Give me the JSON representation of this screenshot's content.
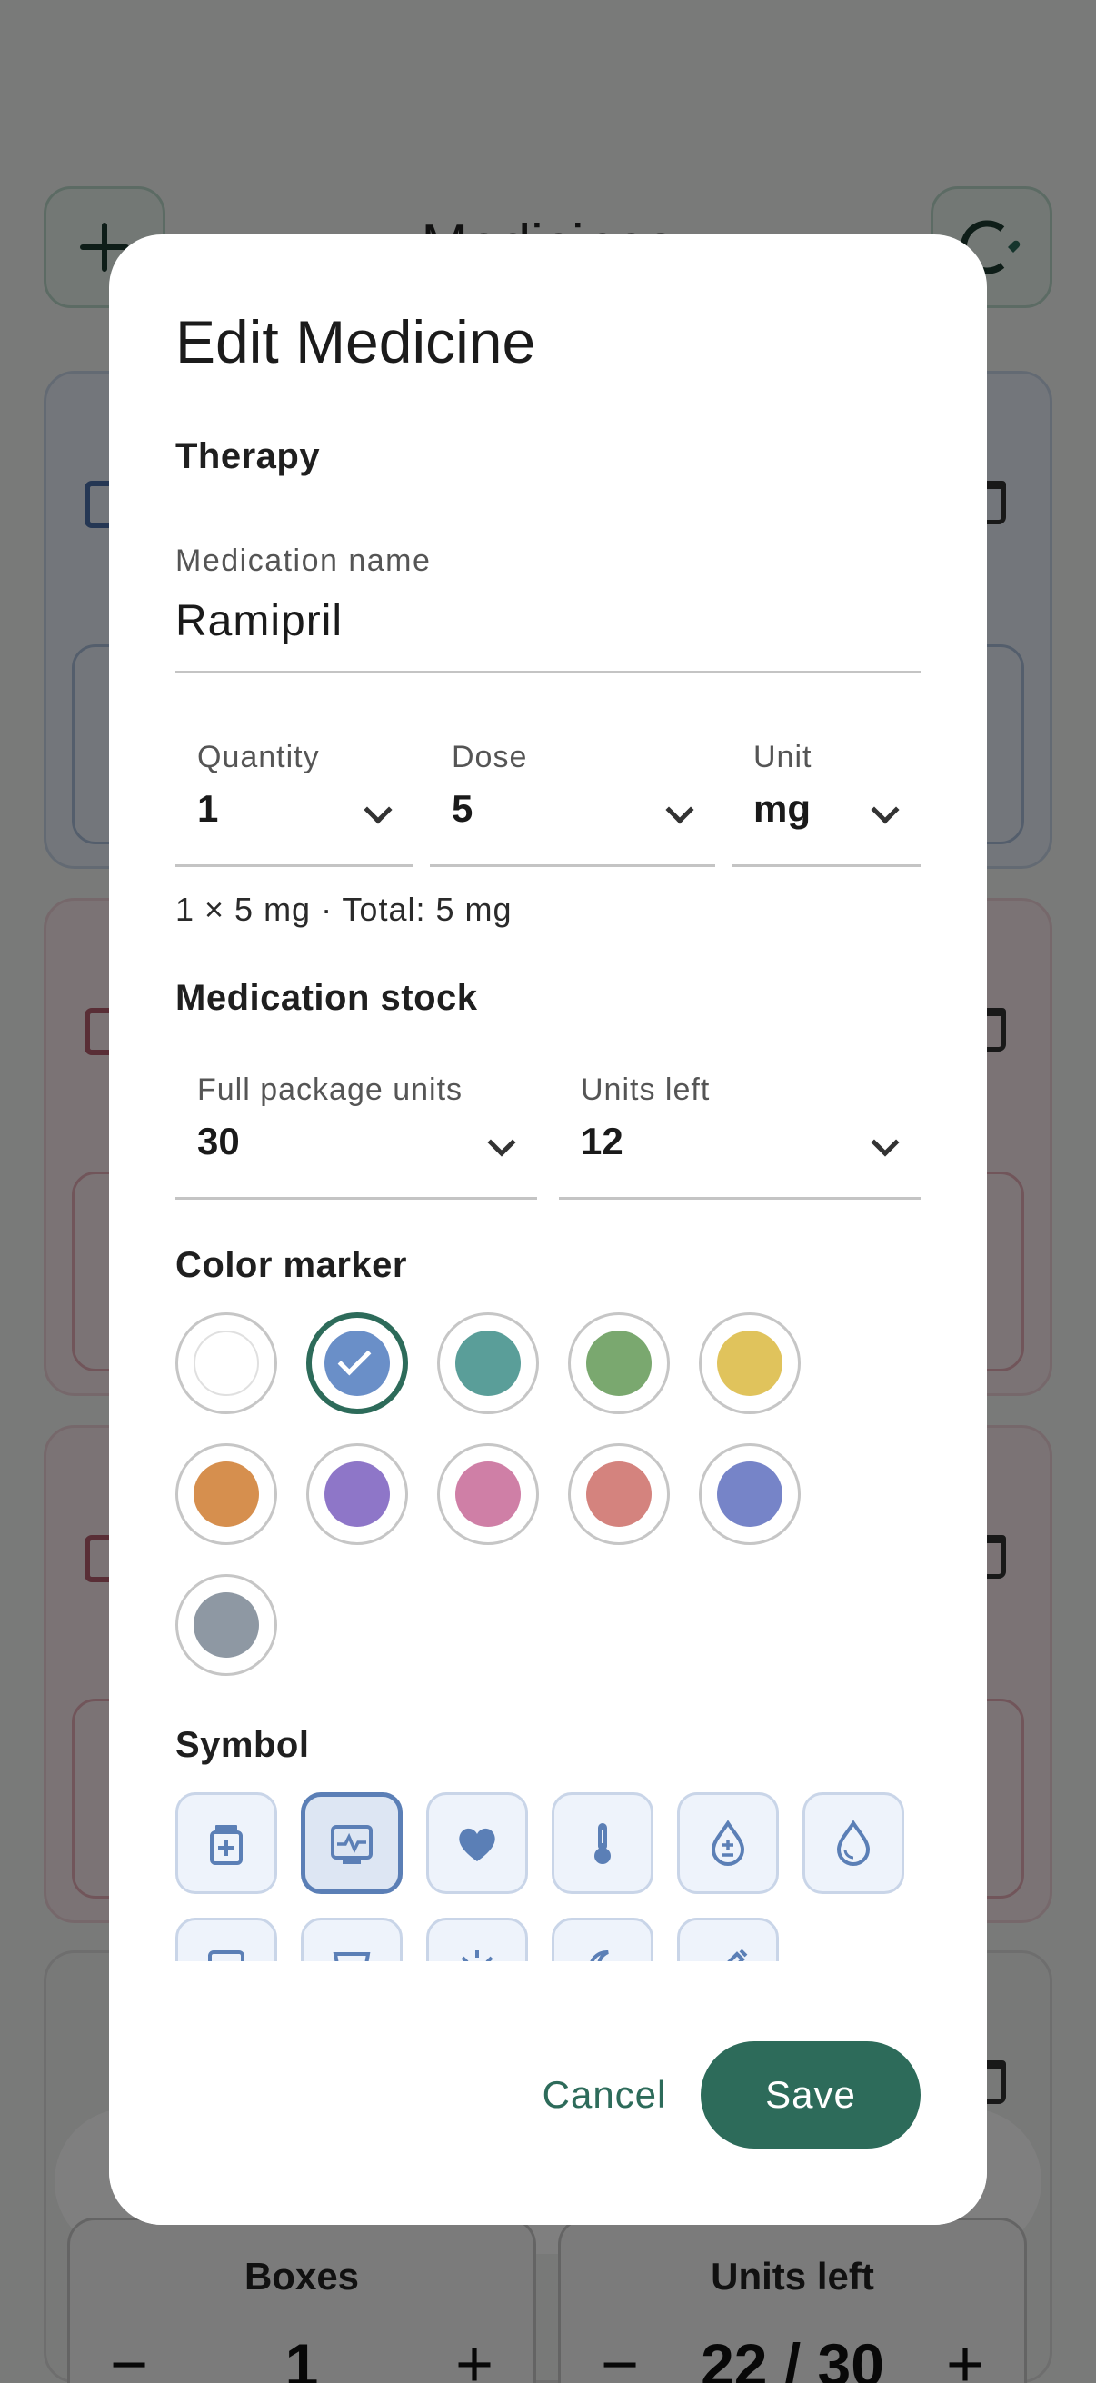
{
  "background": {
    "title": "Medicines",
    "add_icon": "plus-icon",
    "profile_icon": "profile-heart-icon",
    "counters": [
      {
        "label": "Boxes",
        "minus": "−",
        "value": "1",
        "plus": "+"
      },
      {
        "label": "Units left",
        "minus": "−",
        "value": "22 / 30",
        "plus": "+"
      }
    ]
  },
  "dialog": {
    "title": "Edit Medicine",
    "therapy": {
      "section_label": "Therapy",
      "name_label": "Medication name",
      "name_value": "Ramipril",
      "quantity_label": "Quantity",
      "quantity_value": "1",
      "dose_label": "Dose",
      "dose_value": "5",
      "unit_label": "Unit",
      "unit_value": "mg",
      "summary": "1 × 5 mg · Total: 5 mg"
    },
    "stock": {
      "section_label": "Medication stock",
      "full_package_label": "Full package units",
      "full_package_value": "30",
      "units_left_label": "Units left",
      "units_left_value": "12"
    },
    "color_marker": {
      "section_label": "Color marker",
      "selected": "blue",
      "colors": [
        {
          "name": "white",
          "hex": "#ffffff"
        },
        {
          "name": "blue",
          "hex": "#6a8fc8"
        },
        {
          "name": "teal",
          "hex": "#5a9e99"
        },
        {
          "name": "green",
          "hex": "#7aa86f"
        },
        {
          "name": "yellow",
          "hex": "#e0c35c"
        },
        {
          "name": "orange",
          "hex": "#d68f4e"
        },
        {
          "name": "purple",
          "hex": "#8e76c8"
        },
        {
          "name": "pink",
          "hex": "#cf7fa6"
        },
        {
          "name": "salmon",
          "hex": "#d4837e"
        },
        {
          "name": "indigo",
          "hex": "#7684c8"
        },
        {
          "name": "gray",
          "hex": "#8e98a3"
        }
      ]
    },
    "symbol": {
      "section_label": "Symbol",
      "selected": "monitor-pulse-icon",
      "icons": [
        "pill-bottle-icon",
        "monitor-pulse-icon",
        "heart-icon",
        "thermometer-icon",
        "drop-plus-minus-icon",
        "drop-icon",
        "id-card-icon",
        "cup-icon",
        "sun-icon",
        "moon-icon",
        "syringe-icon"
      ]
    },
    "cancel_label": "Cancel",
    "save_label": "Save"
  },
  "colors": {
    "primary": "#2d6b5a",
    "symbol_blue": "#5b7fb6"
  }
}
